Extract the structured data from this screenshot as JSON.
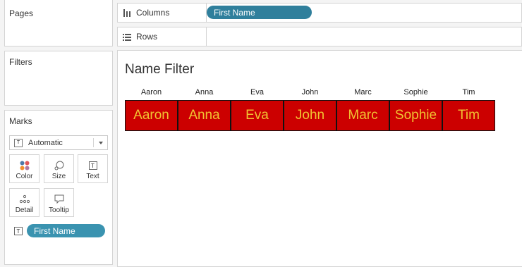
{
  "pages": {
    "title": "Pages"
  },
  "filters": {
    "title": "Filters"
  },
  "marks": {
    "title": "Marks",
    "mark_type": "Automatic",
    "buttons": [
      {
        "label": "Color",
        "icon": "color-icon"
      },
      {
        "label": "Size",
        "icon": "size-icon"
      },
      {
        "label": "Text",
        "icon": "text-icon"
      },
      {
        "label": "Detail",
        "icon": "detail-icon"
      },
      {
        "label": "Tooltip",
        "icon": "tooltip-icon"
      }
    ],
    "field_pill": "First Name"
  },
  "columns_shelf": {
    "label": "Columns",
    "pill": "First Name"
  },
  "rows_shelf": {
    "label": "Rows"
  },
  "view": {
    "title": "Name Filter",
    "headers": [
      "Aaron",
      "Anna",
      "Eva",
      "John",
      "Marc",
      "Sophie",
      "Tim"
    ],
    "cells": [
      "Aaron",
      "Anna",
      "Eva",
      "John",
      "Marc",
      "Sophie",
      "Tim"
    ],
    "cell_color": "#cc0000",
    "text_color": "#f1c232"
  },
  "colors": {
    "pill": "#2f7f9c",
    "mark_pill": "#3a93b0"
  }
}
